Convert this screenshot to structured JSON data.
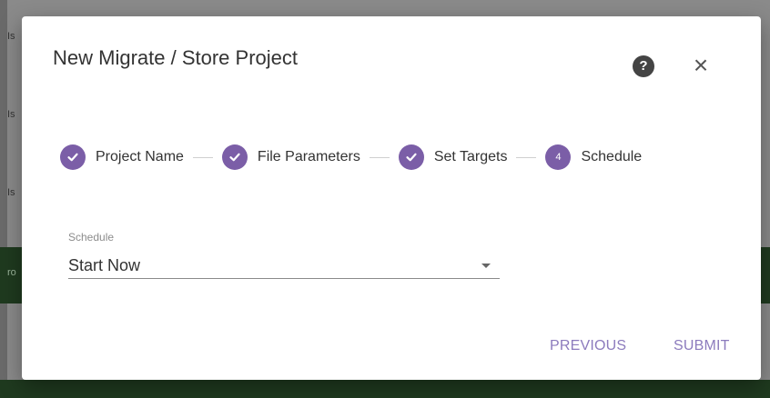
{
  "background": {
    "fragments": [
      "Is",
      "Is",
      "Is",
      "ro"
    ]
  },
  "dialog": {
    "title": "New Migrate / Store Project",
    "help_icon": "?",
    "close_icon": "×"
  },
  "stepper": {
    "steps": [
      {
        "label": "Project Name",
        "state": "complete"
      },
      {
        "label": "File Parameters",
        "state": "complete"
      },
      {
        "label": "Set Targets",
        "state": "complete"
      },
      {
        "label": "Schedule",
        "state": "active",
        "number": "4"
      }
    ],
    "accent_color": "#7b5ea7"
  },
  "schedule": {
    "label": "Schedule",
    "value": "Start Now"
  },
  "actions": {
    "previous": "PREVIOUS",
    "submit": "SUBMIT"
  }
}
